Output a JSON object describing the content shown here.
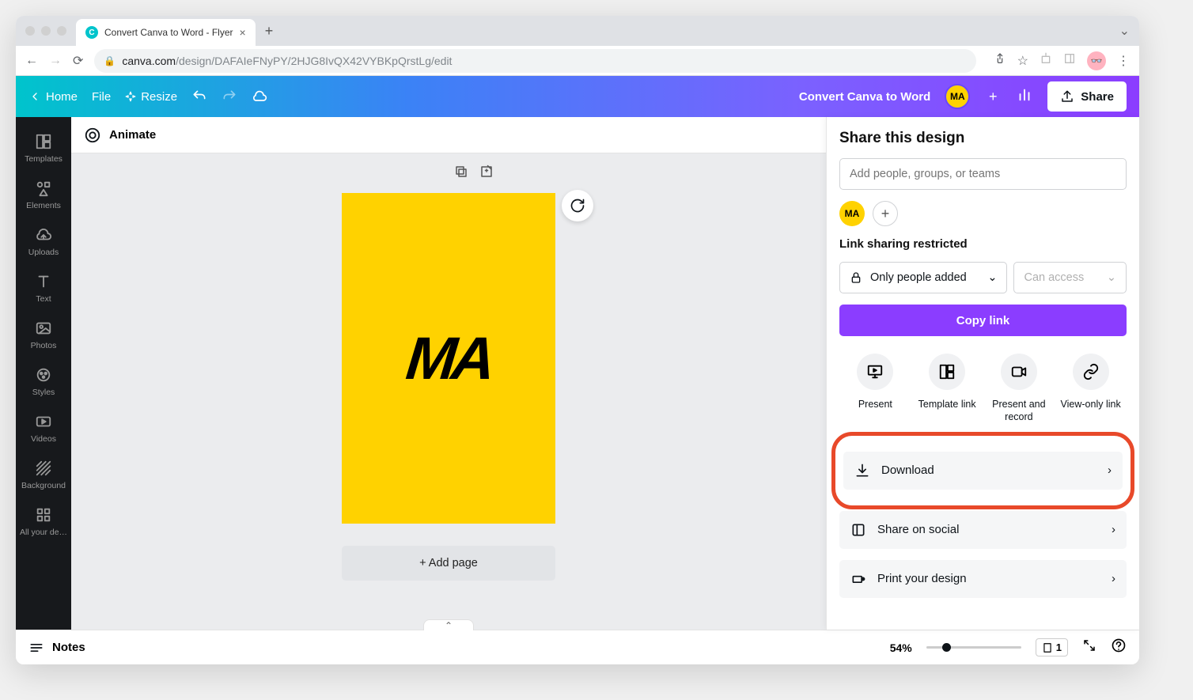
{
  "browser": {
    "tab_title": "Convert Canva to Word - Flyer",
    "url_host": "canva.com",
    "url_path": "/design/DAFAIeFNyPY/2HJG8IvQX42VYBKpQrstLg/edit"
  },
  "header": {
    "home": "Home",
    "file": "File",
    "resize": "Resize",
    "title": "Convert Canva to Word",
    "share": "Share",
    "avatar": "MA"
  },
  "sidebar": {
    "items": [
      {
        "label": "Templates"
      },
      {
        "label": "Elements"
      },
      {
        "label": "Uploads"
      },
      {
        "label": "Text"
      },
      {
        "label": "Photos"
      },
      {
        "label": "Styles"
      },
      {
        "label": "Videos"
      },
      {
        "label": "Background"
      },
      {
        "label": "All your de…"
      }
    ]
  },
  "toolbar": {
    "animate": "Animate"
  },
  "canvas": {
    "text": "MA",
    "add_page": "+ Add page"
  },
  "share_panel": {
    "title": "Share this design",
    "placeholder": "Add people, groups, or teams",
    "avatar": "MA",
    "link_heading": "Link sharing restricted",
    "perm1": "Only people added",
    "perm2": "Can access",
    "copy": "Copy link",
    "actions": [
      {
        "label": "Present"
      },
      {
        "label": "Template link"
      },
      {
        "label": "Present and record"
      },
      {
        "label": "View-only link"
      }
    ],
    "list": [
      {
        "label": "Download"
      },
      {
        "label": "Share on social"
      },
      {
        "label": "Print your design"
      }
    ]
  },
  "footer": {
    "notes": "Notes",
    "zoom": "54%",
    "pages": "1"
  }
}
